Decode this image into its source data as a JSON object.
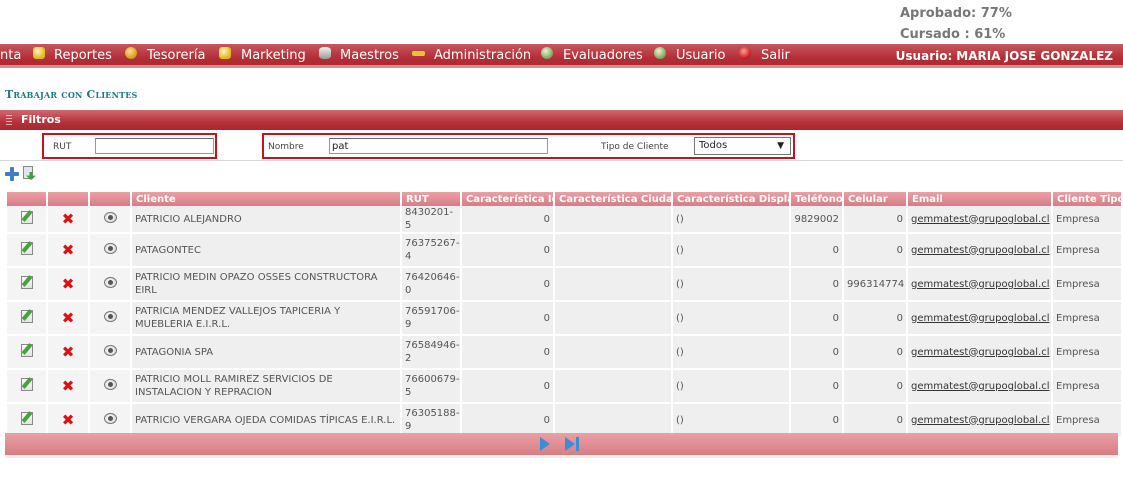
{
  "stats": {
    "aprobado": "Aprobado: 77%",
    "cursado": "Cursado : 61%"
  },
  "menu": {
    "items": [
      {
        "label": "nta",
        "icon": "none"
      },
      {
        "label": "Reportes",
        "icon": "folder-icon"
      },
      {
        "label": "Tesorería",
        "icon": "coin-icon"
      },
      {
        "label": "Marketing",
        "icon": "chat-icon"
      },
      {
        "label": "Maestros",
        "icon": "database-icon"
      },
      {
        "label": "Administración",
        "icon": "key-icon"
      },
      {
        "label": "Evaluadores",
        "icon": "gears-icon"
      },
      {
        "label": "Usuario",
        "icon": "user-gear-icon"
      },
      {
        "label": "Salir",
        "icon": "exit-icon"
      }
    ],
    "user_label": "Usuario:",
    "user_name": "MARIA JOSE GONZALEZ"
  },
  "page": {
    "title": "Trabajar con Clientes"
  },
  "filters": {
    "header": "Filtros",
    "rut_label": "RUT",
    "rut_value": "",
    "nombre_label": "Nombre",
    "nombre_value": "pat",
    "tipo_label": "Tipo de Cliente",
    "tipo_selected": "Todos"
  },
  "table": {
    "columns": [
      "",
      "",
      "",
      "Cliente",
      "RUT",
      "Característica Id",
      "Característica Ciudad",
      "Característica Display",
      "Teléfono",
      "Celular",
      "Email",
      "Cliente Tipo"
    ],
    "rows": [
      {
        "cliente": "PATRICIO ALEJANDRO",
        "rut": "8430201-5",
        "car_id": "0",
        "car_ciudad": "",
        "car_display": "()",
        "telefono": "9829002",
        "celular": "0",
        "email": "gemmatest@grupoglobal.cl",
        "tipo": "Empresa"
      },
      {
        "cliente": "PATAGONTEC",
        "rut": "76375267-4",
        "car_id": "0",
        "car_ciudad": "",
        "car_display": "()",
        "telefono": "0",
        "celular": "0",
        "email": "gemmatest@grupoglobal.cl",
        "tipo": "Empresa"
      },
      {
        "cliente": "PATRICIO MEDIN OPAZO OSSES CONSTRUCTORA EIRL",
        "rut": "76420646-0",
        "car_id": "0",
        "car_ciudad": "",
        "car_display": "()",
        "telefono": "0",
        "celular": "996314774",
        "email": "gemmatest@grupoglobal.cl",
        "tipo": "Empresa"
      },
      {
        "cliente": "PATRICIA MENDEZ VALLEJOS TAPICERIA Y MUEBLERIA E.I.R.L.",
        "rut": "76591706-9",
        "car_id": "0",
        "car_ciudad": "",
        "car_display": "()",
        "telefono": "0",
        "celular": "0",
        "email": "gemmatest@grupoglobal.cl",
        "tipo": "Empresa"
      },
      {
        "cliente": "PATAGONIA SPA",
        "rut": "76584946-2",
        "car_id": "0",
        "car_ciudad": "",
        "car_display": "()",
        "telefono": "0",
        "celular": "0",
        "email": "gemmatest@grupoglobal.cl",
        "tipo": "Empresa"
      },
      {
        "cliente": "PATRICIO MOLL RAMIREZ SERVICIOS DE INSTALACION Y REPRACION",
        "rut": "76600679-5",
        "car_id": "0",
        "car_ciudad": "",
        "car_display": "()",
        "telefono": "0",
        "celular": "0",
        "email": "gemmatest@grupoglobal.cl",
        "tipo": "Empresa"
      },
      {
        "cliente": "PATRICIO VERGARA OJEDA COMIDAS TÍPICAS E.I.R.L.",
        "rut": "76305188-9",
        "car_id": "0",
        "car_ciudad": "",
        "car_display": "()",
        "telefono": "0",
        "celular": "0",
        "email": "gemmatest@grupoglobal.cl",
        "tipo": "Empresa"
      }
    ]
  },
  "pager": {
    "next_icon": "next-page-icon",
    "last_icon": "last-page-icon"
  },
  "colors": {
    "menu_bg": "#b53039",
    "title": "#1a7a86",
    "header_bg": "#d77d84",
    "filter_border": "#c8101e",
    "pager_icons": "#3a8ed6"
  }
}
